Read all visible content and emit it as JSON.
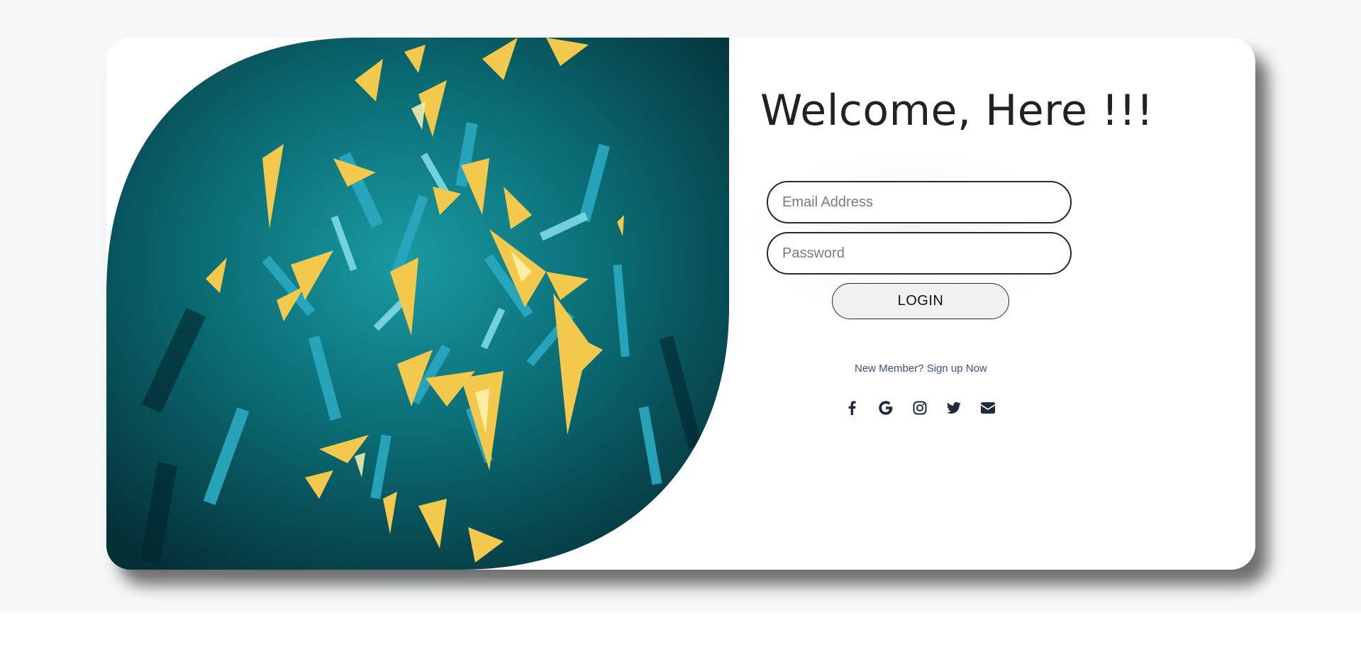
{
  "login": {
    "title": "Welcome, Here !!!",
    "email_placeholder": "Email Address",
    "password_placeholder": "Password",
    "login_label": "LOGIN",
    "signup_text": "New Member? Sign up Now"
  },
  "social_icons": [
    "facebook-icon",
    "google-icon",
    "instagram-icon",
    "twitter-icon",
    "envelope-icon"
  ],
  "colors": {
    "page_background": "#f6f7f9",
    "card_background": "#ffffff",
    "art_background": "#0d6f75",
    "art_accent_gold": "#f2c94c",
    "art_accent_cyan": "#3fb9cf",
    "link_color": "#3a4d86",
    "text_dark": "#222222"
  }
}
